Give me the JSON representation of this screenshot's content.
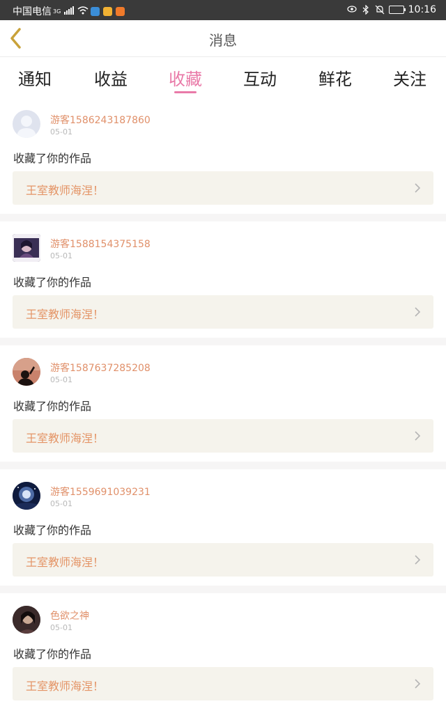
{
  "status_bar": {
    "carrier": "中国电信",
    "network": "3G",
    "time": "10:16"
  },
  "header": {
    "title": "消息"
  },
  "tabs": [
    {
      "label": "通知"
    },
    {
      "label": "收益"
    },
    {
      "label": "收藏",
      "active": true
    },
    {
      "label": "互动"
    },
    {
      "label": "鲜花"
    },
    {
      "label": "关注"
    }
  ],
  "notifications": [
    {
      "user": "游客1586243187860",
      "date": "05-01",
      "action": "收藏了你的作品",
      "work_title": "王室教师海涅！",
      "avatar": "default-avatar"
    },
    {
      "user": "游客1588154375158",
      "date": "05-01",
      "action": "收藏了你的作品",
      "work_title": "王室教师海涅！",
      "avatar": "girl-avatar"
    },
    {
      "user": "游客1587637285208",
      "date": "05-01",
      "action": "收藏了你的作品",
      "work_title": "王室教师海涅！",
      "avatar": "sunset-silhouette-avatar"
    },
    {
      "user": "游客1559691039231",
      "date": "05-01",
      "action": "收藏了你的作品",
      "work_title": "王室教师海涅！",
      "avatar": "night-sky-avatar"
    },
    {
      "user": "色欲之神",
      "date": "05-01",
      "action": "收藏了你的作品",
      "work_title": "王室教师海涅！",
      "avatar": "dark-portrait-avatar"
    }
  ],
  "colors": {
    "accent": "#e97aa8",
    "username": "#e0906a",
    "work_title": "#e49466",
    "work_box_bg": "#f5f3ec",
    "back_arrow": "#c9a23a"
  }
}
